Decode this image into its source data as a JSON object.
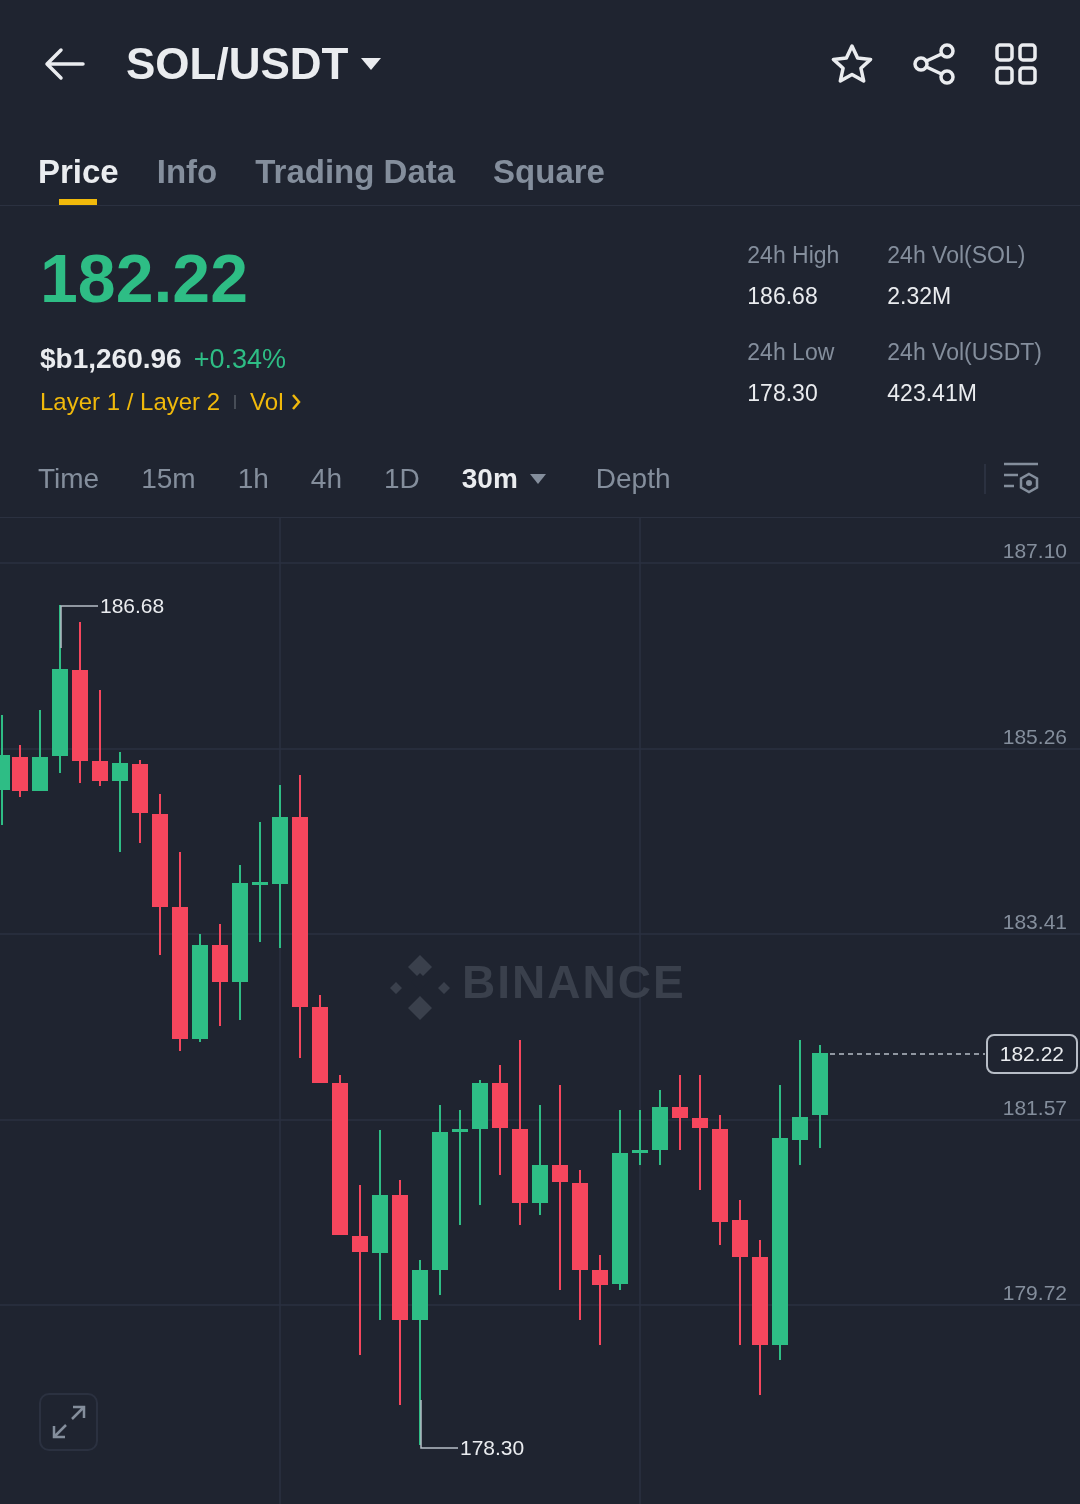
{
  "header": {
    "pair": "SOL/USDT"
  },
  "tabs": [
    {
      "label": "Price",
      "selected": true
    },
    {
      "label": "Info",
      "selected": false
    },
    {
      "label": "Trading Data",
      "selected": false
    },
    {
      "label": "Square",
      "selected": false
    }
  ],
  "ticker": {
    "last_price": "182.22",
    "fiat_price": "$b1,260.96",
    "change": "+0.34%",
    "tags": [
      "Layer 1 / Layer 2",
      "Vol"
    ]
  },
  "stats": [
    {
      "label": "24h High",
      "value": "186.68"
    },
    {
      "label": "24h Vol(SOL)",
      "value": "2.32M"
    },
    {
      "label": "24h Low",
      "value": "178.30"
    },
    {
      "label": "24h Vol(USDT)",
      "value": "423.41M"
    }
  ],
  "intervals": [
    {
      "label": "Time",
      "kind": "plain",
      "selected": false
    },
    {
      "label": "15m",
      "kind": "plain",
      "selected": false
    },
    {
      "label": "1h",
      "kind": "plain",
      "selected": false
    },
    {
      "label": "4h",
      "kind": "plain",
      "selected": false
    },
    {
      "label": "1D",
      "kind": "plain",
      "selected": false
    },
    {
      "label": "30m",
      "kind": "dropdown",
      "selected": true
    },
    {
      "label": "Depth",
      "kind": "plain",
      "selected": false
    }
  ],
  "chart": {
    "y_labels": [
      "187.10",
      "185.26",
      "183.41",
      "181.57",
      "179.72"
    ],
    "high_label": "186.68",
    "low_label": "178.30",
    "current_price": "182.22",
    "watermark": "BINANCE"
  }
}
